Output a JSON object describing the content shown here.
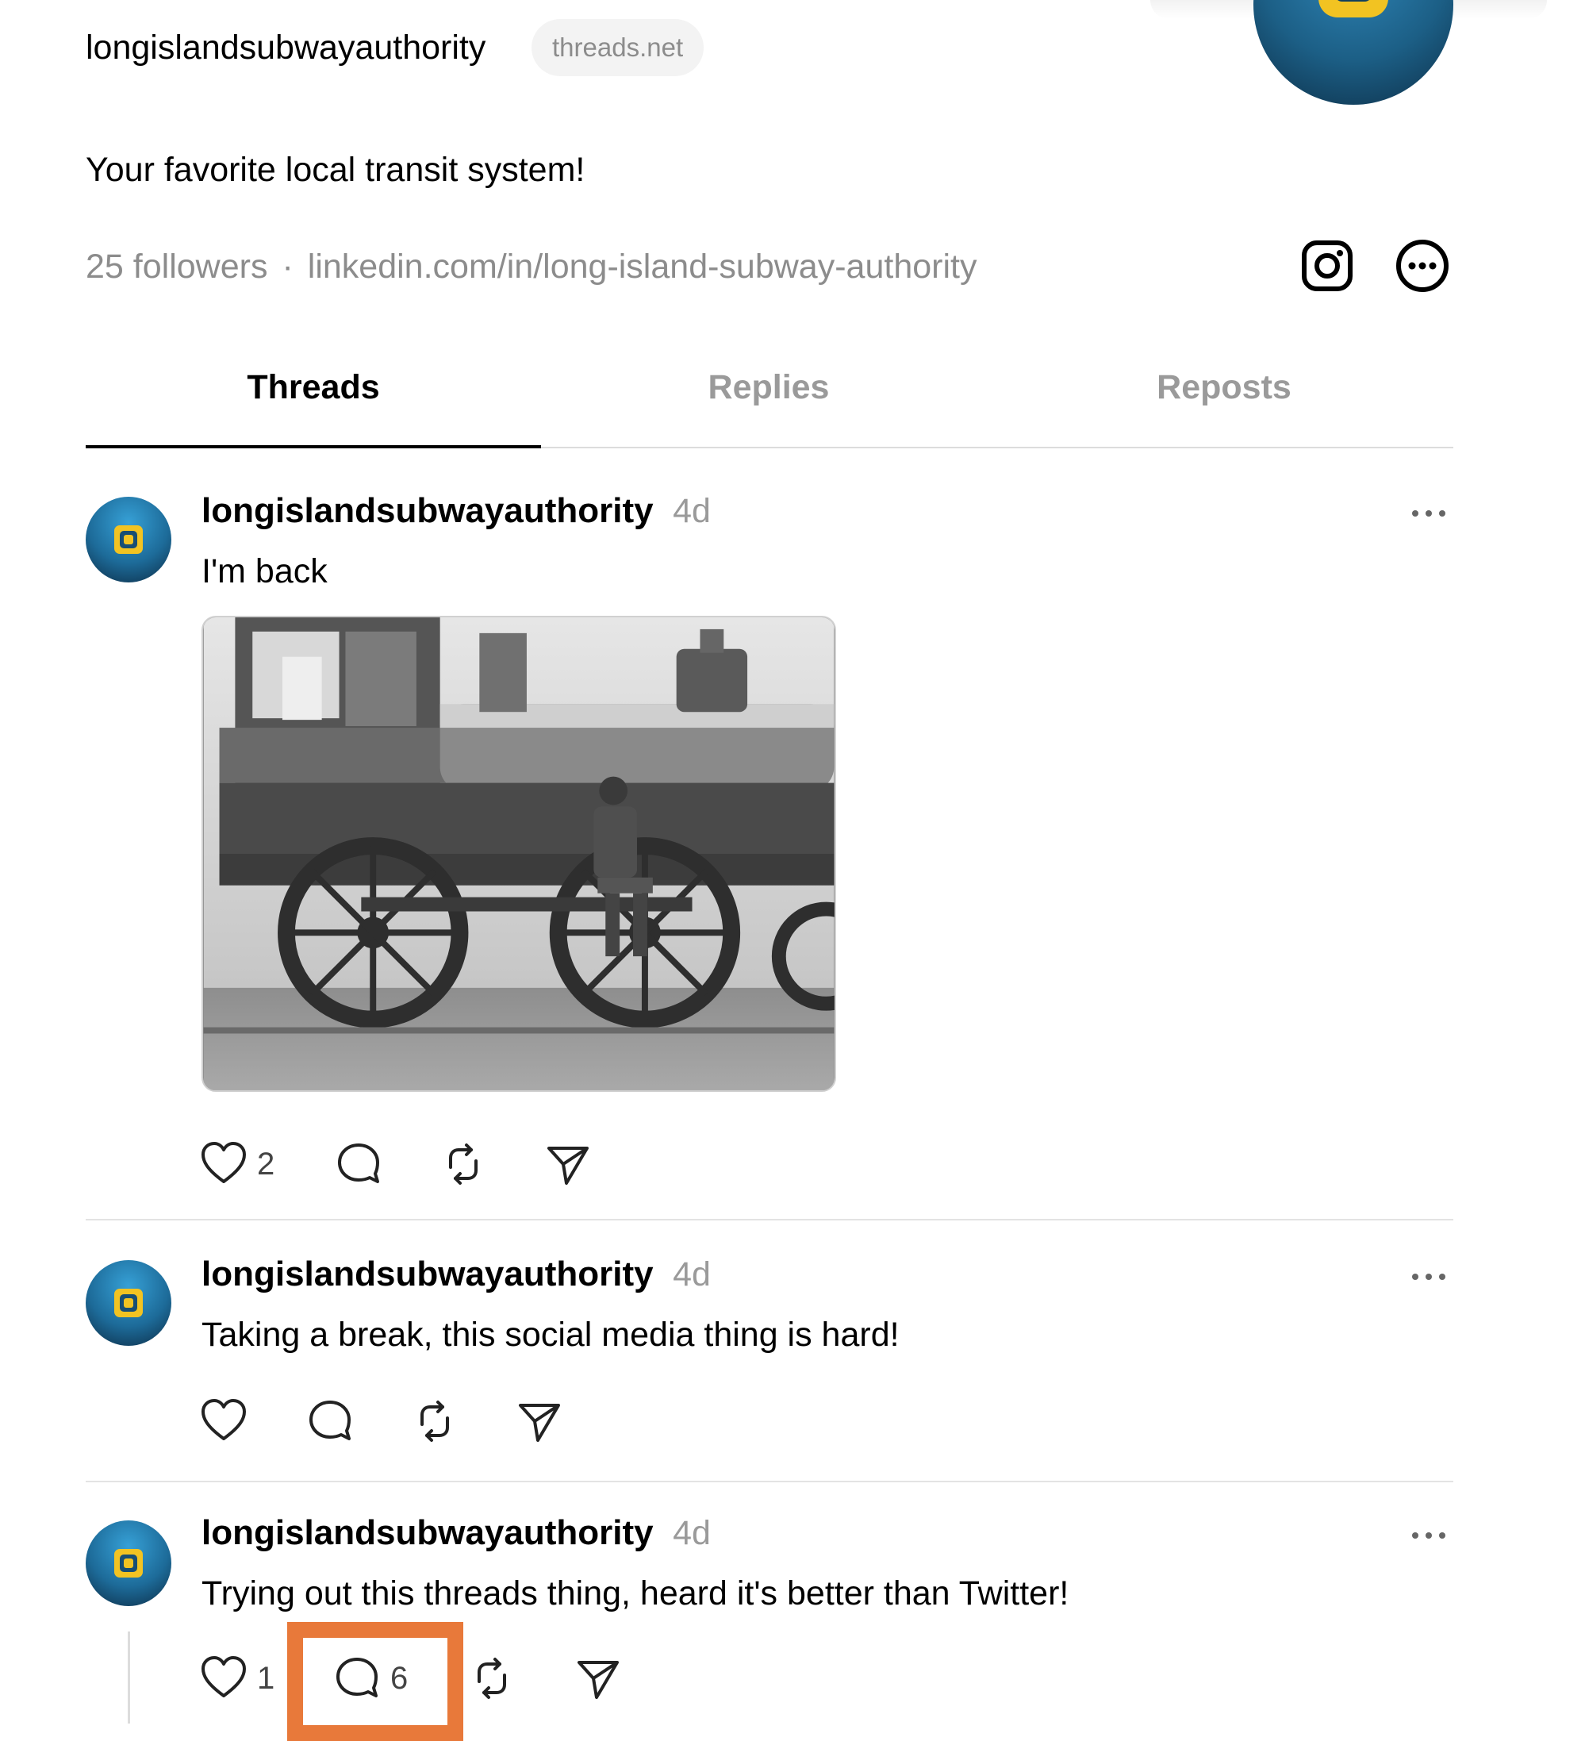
{
  "profile": {
    "handle": "longislandsubwayauthority",
    "domain_badge": "threads.net",
    "bio": "Your favorite local transit system!",
    "followers": "25 followers",
    "separator": "·",
    "link": "linkedin.com/in/long-island-subway-authority"
  },
  "tabs": [
    {
      "label": "Threads",
      "active": true
    },
    {
      "label": "Replies",
      "active": false
    },
    {
      "label": "Reposts",
      "active": false
    }
  ],
  "posts": [
    {
      "user": "longislandsubwayauthority",
      "time": "4d",
      "text": "I'm back",
      "likes": "2",
      "replies": "",
      "has_media": true
    },
    {
      "user": "longislandsubwayauthority",
      "time": "4d",
      "text": "Taking a break, this social media thing is hard!",
      "likes": "",
      "replies": ""
    },
    {
      "user": "longislandsubwayauthority",
      "time": "4d",
      "text": "Trying out this threads thing, heard it's better than Twitter!",
      "likes": "1",
      "replies": "6"
    }
  ],
  "icons": {
    "instagram": "instagram-icon",
    "more": "more-circle-icon",
    "like": "heart-icon",
    "reply": "comment-icon",
    "repost": "repost-icon",
    "share": "send-icon"
  },
  "colors": {
    "highlight": "#e8793a",
    "muted_text": "#8c8c8c",
    "avatar_blue": "#1d6b99",
    "logo_yellow": "#f2c322"
  }
}
